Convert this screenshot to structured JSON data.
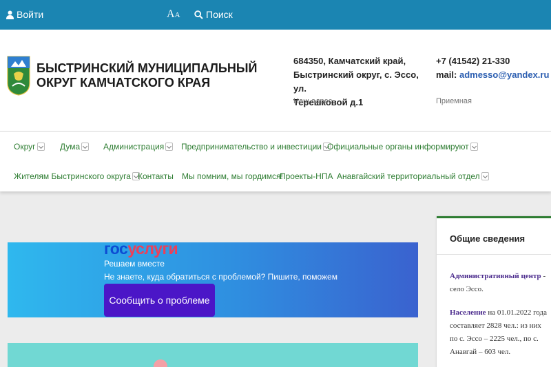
{
  "topbar": {
    "login": "Войти",
    "font_big": "A",
    "font_small": "A",
    "search": "Поиск"
  },
  "header": {
    "title": "БЫСТРИНСКИЙ МУНИЦИПАЛЬНЫЙ ОКРУГ КАМЧАТСКОГО КРАЯ",
    "address_line1": "684350, Камчатский край,",
    "address_line2": "Быстринский округ, с. Эссо, ул.",
    "address_line3": "Терешковой д.1",
    "address_caption": "Наш адрес",
    "phone": "+7 (41542) 21-330",
    "mail_label": "mail:",
    "mail_value": "admesso@yandex.ru",
    "phone_caption": "Приемная"
  },
  "nav": {
    "row1": [
      "Округ",
      "Дума",
      "Администрация",
      "Предпринимательство и инвестиции",
      "Официальные органы информируют"
    ],
    "row2": [
      "Жителям Быстринского округа",
      "Контакты",
      "Мы помним, мы гордимся!",
      "Проекты-НПА",
      "Анавгайский территориальный отдел"
    ]
  },
  "banner": {
    "logo_gos": "гос",
    "logo_uslugi": "услуги",
    "line1": "Решаем вместе",
    "line2": "Не знаете, куда обратиться с проблемой? Пишите, поможем",
    "button": "Сообщить о проблеме"
  },
  "sidebar": {
    "heading": "Общие сведения",
    "admin_center_label": "Административный центр",
    "admin_center_value": " - село Эссо.",
    "population_label": "Население",
    "population_value": " на 01.01.2022 года составляет 2828 чел.: из них по с. Эссо – 2225 чел., по с. Анавгай – 603 чел."
  },
  "colors": {
    "topbar": "#1b85b2",
    "nav_link": "#2e7d32",
    "button": "#4b16c7",
    "mail_link": "#2a5db0"
  }
}
